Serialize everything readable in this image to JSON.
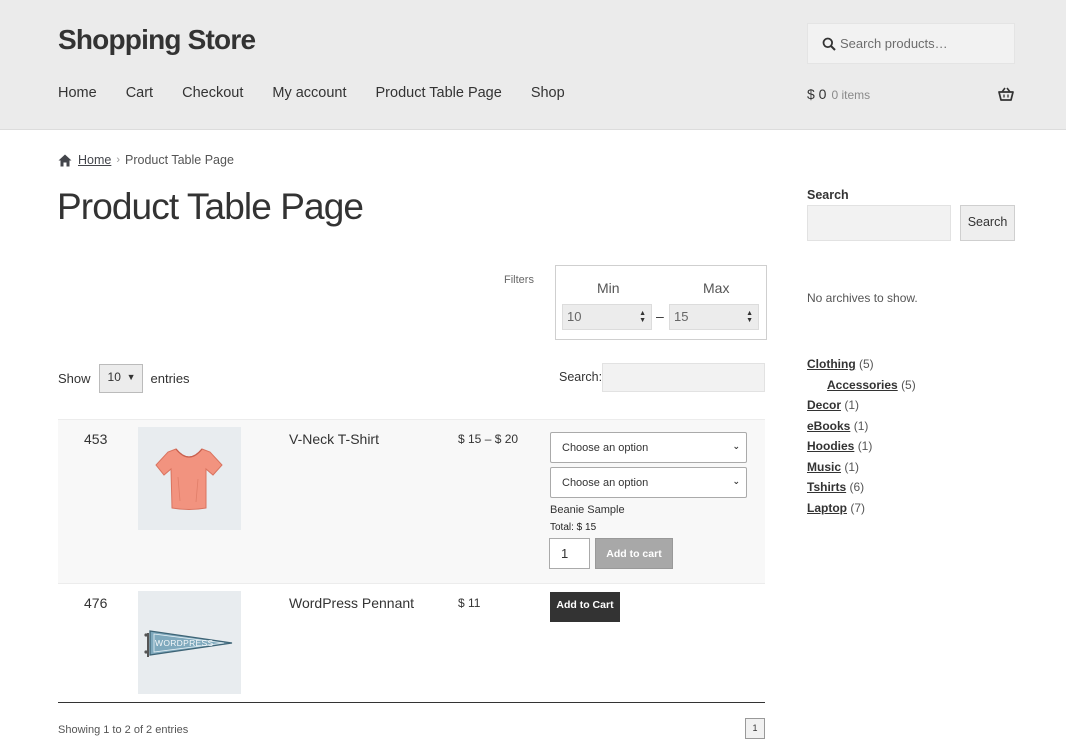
{
  "site": {
    "title": "Shopping Store"
  },
  "header": {
    "search_placeholder": "Search products…",
    "nav": [
      "Home",
      "Cart",
      "Checkout",
      "My account",
      "Product Table Page",
      "Shop"
    ],
    "cart_amount": "$ 0",
    "cart_count": "0 items"
  },
  "breadcrumb": {
    "home": "Home",
    "separator": "›",
    "current": "Product Table Page"
  },
  "page": {
    "title": "Product Table Page"
  },
  "filters": {
    "label": "Filters",
    "min_label": "Min",
    "max_label": "Max",
    "min_value": "10",
    "max_value": "15",
    "dash": "–"
  },
  "table_controls": {
    "show_label": "Show",
    "length_value": "10",
    "entries_label": "entries",
    "search_label": "Search:"
  },
  "rows": [
    {
      "id": "453",
      "name": "V-Neck T-Shirt",
      "price": "$ 15 – $ 20",
      "variation_1": "Choose an option",
      "variation_2": "Choose an option",
      "variation_name": "Beanie Sample",
      "total": "Total: $ 15",
      "quantity": "1",
      "button": "Add to cart"
    },
    {
      "id": "476",
      "name": "WordPress Pennant",
      "price": "$ 11",
      "button": "Add to Cart",
      "pennant_text": "WORDPRESS"
    }
  ],
  "table_footer": {
    "info": "Showing 1 to 2 of 2 entries",
    "page": "1"
  },
  "sidebar": {
    "search_title": "Search",
    "search_button": "Search",
    "archives_empty": "No archives to show.",
    "categories": [
      {
        "name": "Clothing",
        "count": "(5)",
        "child": false
      },
      {
        "name": "Accessories",
        "count": "(5)",
        "child": true
      },
      {
        "name": "Decor",
        "count": "(1)",
        "child": false
      },
      {
        "name": "eBooks",
        "count": "(1)",
        "child": false
      },
      {
        "name": "Hoodies",
        "count": "(1)",
        "child": false
      },
      {
        "name": "Music",
        "count": "(1)",
        "child": false
      },
      {
        "name": "Tshirts",
        "count": "(6)",
        "child": false
      },
      {
        "name": "Laptop",
        "count": "(7)",
        "child": false
      }
    ]
  },
  "colors": {
    "header_bg": "#ebebeb",
    "button_dark": "#333333",
    "button_disabled": "#a8a8a8",
    "tshirt": "#f2937f",
    "pennant": "#7fa9bd"
  }
}
